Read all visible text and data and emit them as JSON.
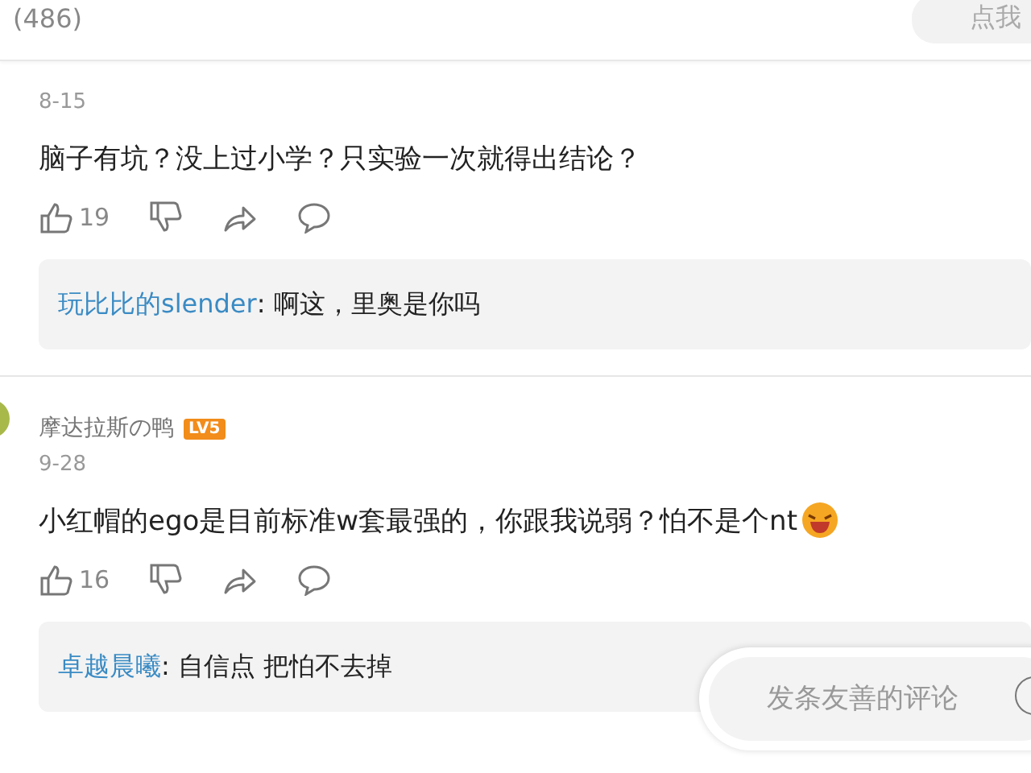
{
  "header": {
    "count": "(486)",
    "button": "点我"
  },
  "comments": [
    {
      "date": "8-15",
      "text": "脑子有坑？没上过小学？只实验一次就得出结论？",
      "emoji": false,
      "likes": "19",
      "reply": {
        "user": "玩比比的slender",
        "text": ": 啊这，里奥是你吗"
      }
    },
    {
      "name": "摩达拉斯の鸭",
      "level_badge": "LV5",
      "date": "9-28",
      "text": "小红帽的ego是目前标准w套最强的，你跟我说弱？怕不是个nt",
      "emoji": true,
      "likes": "16",
      "reply": {
        "user": "卓越晨曦",
        "text": ": 自信点 把怕不去掉"
      }
    }
  ],
  "input": {
    "placeholder": "发条友善的评论"
  }
}
